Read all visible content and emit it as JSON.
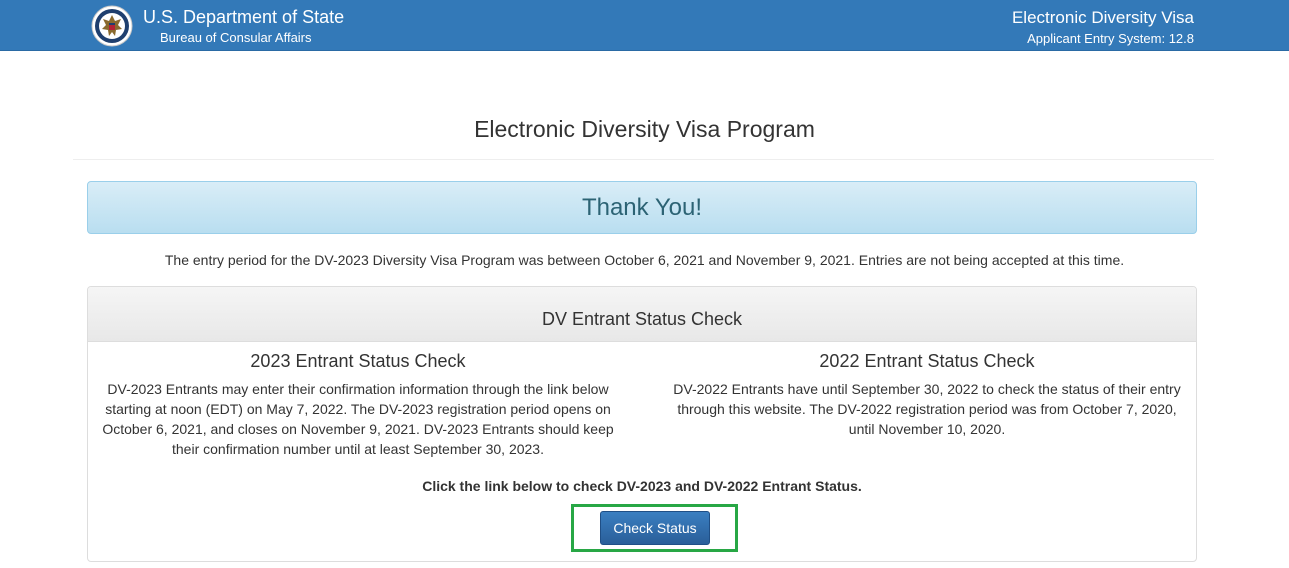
{
  "header": {
    "dept_title": "U.S. Department of State",
    "dept_subtitle": "Bureau of Consular Affairs",
    "system_title": "Electronic Diversity Visa",
    "system_subtitle": "Applicant Entry System: 12.8",
    "bg_color": "#3379b8",
    "seal_icon": "state-department-seal-icon"
  },
  "main": {
    "page_title": "Electronic Diversity Visa Program",
    "thank_you": "Thank You!",
    "entry_period_text": "The entry period for the DV-2023 Diversity Visa Program was between October 6, 2021 and November 9, 2021. Entries are not being accepted at this time."
  },
  "panel": {
    "title": "DV Entrant Status Check",
    "left": {
      "heading": "2023 Entrant Status Check",
      "body": "DV-2023 Entrants may enter their confirmation information through the link below starting at noon (EDT) on May 7, 2022. The DV-2023 registration period opens on October 6, 2021, and closes on November 9, 2021. DV-2023 Entrants should keep their confirmation number until at least September 30, 2023."
    },
    "right": {
      "heading": "2022 Entrant Status Check",
      "body": "DV-2022 Entrants have until September 30, 2022 to check the status of their entry through this website. The DV-2022 registration period was from October 7, 2020, until November 10, 2020."
    },
    "cta_text": "Click the link below to check DV-2023 and DV-2022 Entrant Status.",
    "check_status_label": "Check Status",
    "highlight_color": "#28a745"
  }
}
